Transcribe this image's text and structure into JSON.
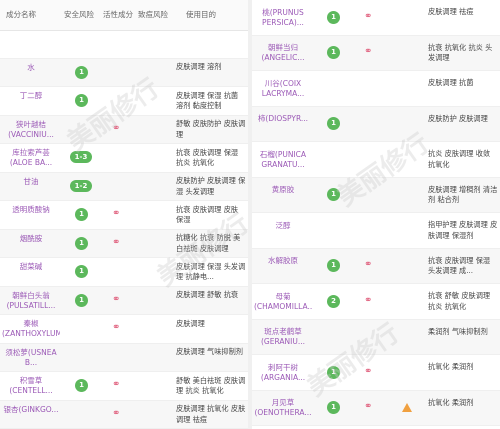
{
  "headers": {
    "name": "成分名称",
    "safety": "安全风险",
    "active": "活性成分",
    "acne": "致痘风险",
    "purpose": "使用目的"
  },
  "watermark": "美丽修行",
  "left_rows": [
    {
      "name": "",
      "safety": "",
      "active": false,
      "acne": false,
      "purpose": ""
    },
    {
      "name": "水",
      "safety": "1",
      "active": false,
      "acne": false,
      "purpose": "皮肤调理 溶剂"
    },
    {
      "name": "丁二醇",
      "safety": "1",
      "active": false,
      "acne": false,
      "purpose": "皮肤调理 保湿 抗菌 溶剂 黏度控制"
    },
    {
      "name": "狭叶越桔(VACCINIU...",
      "safety": "",
      "active": true,
      "acne": false,
      "purpose": "舒敏 皮肤防护 皮肤调理"
    },
    {
      "name": "库拉索芦荟(ALOE BA...",
      "safety": "1-3",
      "active": false,
      "acne": false,
      "purpose": "抗衰 皮肤调理 保湿 抗炎 抗氧化"
    },
    {
      "name": "甘油",
      "safety": "1-2",
      "active": false,
      "acne": false,
      "purpose": "皮肤防护 皮肤调理 保湿 头发调理"
    },
    {
      "name": "透明质酸钠",
      "safety": "1",
      "active": true,
      "acne": false,
      "purpose": "抗衰 皮肤调理 皮肤 保湿"
    },
    {
      "name": "烟酰胺",
      "safety": "1",
      "active": true,
      "acne": false,
      "purpose": "抗糖化 抗衰 防脱 美白祛斑 皮肤调理"
    },
    {
      "name": "甜菜碱",
      "safety": "1",
      "active": false,
      "acne": false,
      "purpose": "皮肤调理 保湿 头发调理 抗静电..."
    },
    {
      "name": "朝鲜白头翁(PULSATILL...",
      "safety": "1",
      "active": true,
      "acne": false,
      "purpose": "皮肤调理 舒敏 抗衰"
    },
    {
      "name": "秦椒(ZANTHOXYLUM...",
      "safety": "",
      "active": true,
      "acne": false,
      "purpose": "皮肤调理"
    },
    {
      "name": "须松萝(USNEA B...",
      "safety": "",
      "active": false,
      "acne": false,
      "purpose": "皮肤调理 气味抑制剂"
    },
    {
      "name": "积雪草(CENTELL...",
      "safety": "1",
      "active": true,
      "acne": false,
      "purpose": "舒敏 美白祛斑 皮肤调理 抗炎 抗氧化"
    },
    {
      "name": "银杏(GINKGO...",
      "safety": "",
      "active": true,
      "acne": false,
      "purpose": "皮肤调理 抗氧化 皮肤调理 祛痘"
    }
  ],
  "right_rows": [
    {
      "name": "桃(PRUNUS PERSICA)...",
      "safety": "1",
      "active": true,
      "acne": false,
      "purpose": "皮肤调理 祛痘"
    },
    {
      "name": "朝鲜当归(ANGELIC...",
      "safety": "1",
      "active": true,
      "acne": false,
      "purpose": "抗衰 抗氧化 抗炎 头发调理"
    },
    {
      "name": "川谷(COIX LACRYMA...",
      "safety": "",
      "active": false,
      "acne": false,
      "purpose": "皮肤调理 抗菌"
    },
    {
      "name": "柿(DIOSPYR...",
      "safety": "1",
      "active": false,
      "acne": false,
      "purpose": "皮肤防护 皮肤调理"
    },
    {
      "name": "石榴(PUNICA GRANATU...",
      "safety": "",
      "active": false,
      "acne": false,
      "purpose": "抗炎 皮肤调理 收敛 抗氧化"
    },
    {
      "name": "黄原胶",
      "safety": "1",
      "active": false,
      "acne": false,
      "purpose": "皮肤调理 增稠剂 清洁剂 粘合剂"
    },
    {
      "name": "泛醇",
      "safety": "",
      "active": false,
      "acne": false,
      "purpose": "指甲护理 皮肤调理 皮肤调理 保湿剂"
    },
    {
      "name": "水解胶原",
      "safety": "1",
      "active": true,
      "acne": false,
      "purpose": "抗衰 皮肤调理 保湿 头发调理 成..."
    },
    {
      "name": "母菊(CHAMOMILLA...",
      "safety": "2",
      "active": true,
      "acne": false,
      "purpose": "抗衰 舒敏 皮肤调理 抗炎 抗氧化"
    },
    {
      "name": "斑点老鹳草(GERANIU...",
      "safety": "",
      "active": false,
      "acne": false,
      "purpose": "柔润剂 气味抑制剂"
    },
    {
      "name": "刺阿干树(ARGANIA...",
      "safety": "1",
      "active": true,
      "acne": false,
      "purpose": "抗氧化 柔润剂"
    },
    {
      "name": "月见草(OENOTHERA...",
      "safety": "1",
      "active": true,
      "acne": true,
      "purpose": "抗氧化 柔润剂"
    }
  ]
}
